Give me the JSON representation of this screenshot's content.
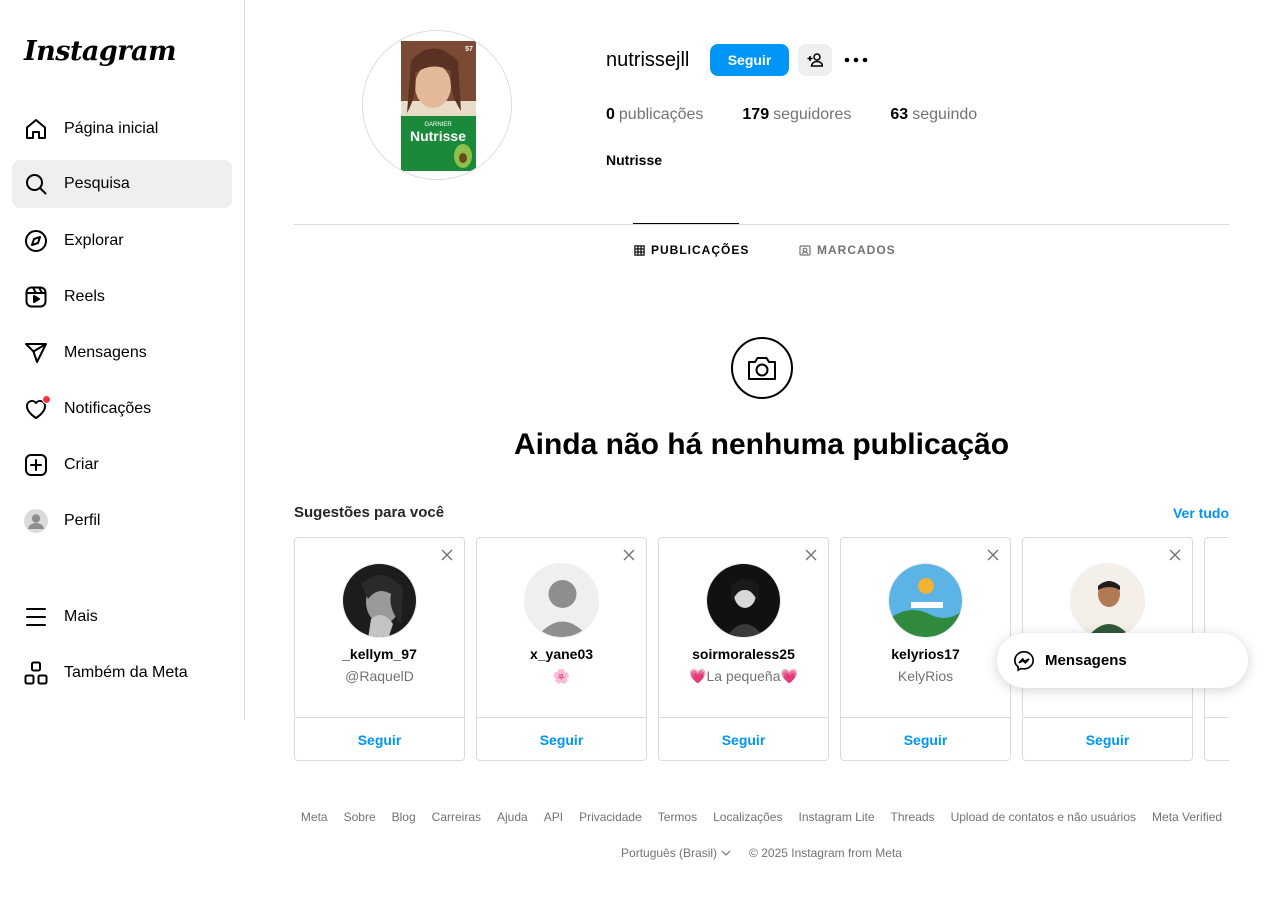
{
  "app": {
    "logo": "Instagram"
  },
  "sidebar": {
    "items": [
      {
        "label": "Página inicial",
        "icon": "home-icon"
      },
      {
        "label": "Pesquisa",
        "icon": "search-icon",
        "active": true
      },
      {
        "label": "Explorar",
        "icon": "compass-icon"
      },
      {
        "label": "Reels",
        "icon": "reels-icon"
      },
      {
        "label": "Mensagens",
        "icon": "send-icon"
      },
      {
        "label": "Notificações",
        "icon": "heart-icon",
        "has_dot": true
      },
      {
        "label": "Criar",
        "icon": "plus-square-icon"
      },
      {
        "label": "Perfil",
        "icon": "avatar-icon"
      },
      {
        "label": "Mais",
        "icon": "hamburger-icon"
      },
      {
        "label": "Também da Meta",
        "icon": "meta-apps-icon"
      }
    ]
  },
  "profile": {
    "username": "nutrissejll",
    "follow_label": "Seguir",
    "stats": {
      "posts_count": "0",
      "posts_label": "publicações",
      "followers_count": "179",
      "followers_label": "seguidores",
      "following_count": "63",
      "following_label": "seguindo"
    },
    "full_name": "Nutrisse",
    "avatar_text": {
      "brand": "GARNIER",
      "product": "Nutrisse",
      "shade": "57"
    }
  },
  "tabs": [
    {
      "label": "PUBLICAÇÕES",
      "active": true
    },
    {
      "label": "MARCADOS",
      "active": false
    }
  ],
  "empty_state": {
    "title": "Ainda não há nenhuma publicação"
  },
  "suggestions": {
    "title": "Sugestões para você",
    "see_all": "Ver tudo",
    "follow_label": "Seguir",
    "cards": [
      {
        "username": "_kellym_97",
        "subtitle": "@RaquelD"
      },
      {
        "username": "x_yane03",
        "subtitle": "🌸"
      },
      {
        "username": "soirmoraless25",
        "subtitle": "💗La pequeña💗"
      },
      {
        "username": "kelyrios17",
        "subtitle": "KelyRios"
      },
      {
        "username": "",
        "subtitle": ""
      }
    ]
  },
  "messages_pill": {
    "label": "Mensagens"
  },
  "footer": {
    "links": [
      "Meta",
      "Sobre",
      "Blog",
      "Carreiras",
      "Ajuda",
      "API",
      "Privacidade",
      "Termos",
      "Localizações",
      "Instagram Lite",
      "Threads",
      "Upload de contatos e não usuários",
      "Meta Verified"
    ],
    "language": "Português (Brasil)",
    "copyright": "© 2025 Instagram from Meta"
  },
  "colors": {
    "accent": "#0095f6",
    "notification": "#ff3040",
    "muted": "#737373",
    "border": "#dbdbdb"
  }
}
